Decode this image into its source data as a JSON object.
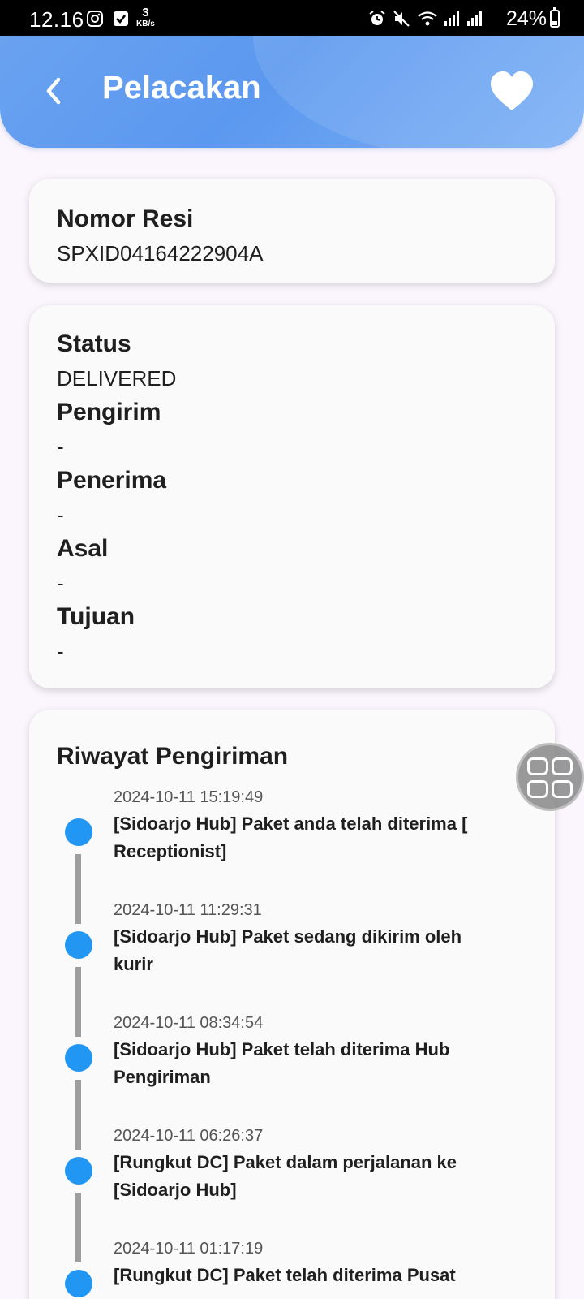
{
  "status_bar": {
    "time": "12.16",
    "net_speed": "3",
    "net_unit": "KB/s",
    "battery": "24%"
  },
  "app_bar": {
    "title": "Pelacakan",
    "back_icon": "chevron-left-icon",
    "favorite_icon": "heart-icon"
  },
  "resi": {
    "label": "Nomor Resi",
    "value": "SPXID04164222904A"
  },
  "details": [
    {
      "label": "Status",
      "value": "DELIVERED"
    },
    {
      "label": "Pengirim",
      "value": "-"
    },
    {
      "label": "Penerima",
      "value": "-"
    },
    {
      "label": "Asal",
      "value": "-"
    },
    {
      "label": "Tujuan",
      "value": "-"
    }
  ],
  "history": {
    "title": "Riwayat Pengiriman",
    "items": [
      {
        "date": "2024-10-11 15:19:49",
        "text": "[Sidoarjo Hub] Paket anda telah diterima [ Receptionist]"
      },
      {
        "date": "2024-10-11 11:29:31",
        "text": "[Sidoarjo Hub] Paket sedang dikirim oleh kurir"
      },
      {
        "date": "2024-10-11 08:34:54",
        "text": "[Sidoarjo Hub] Paket telah diterima Hub Pengiriman"
      },
      {
        "date": "2024-10-11 06:26:37",
        "text": "[Rungkut DC] Paket dalam perjalanan ke [Sidoarjo Hub]"
      },
      {
        "date": "2024-10-11 01:17:19",
        "text": "[Rungkut DC] Paket telah diterima Pusat"
      }
    ]
  },
  "colors": {
    "appbar": "#5b98ef",
    "timeline_dot": "#2196f3",
    "timeline_line": "#9e9e9e",
    "background": "#fbf6fd"
  }
}
